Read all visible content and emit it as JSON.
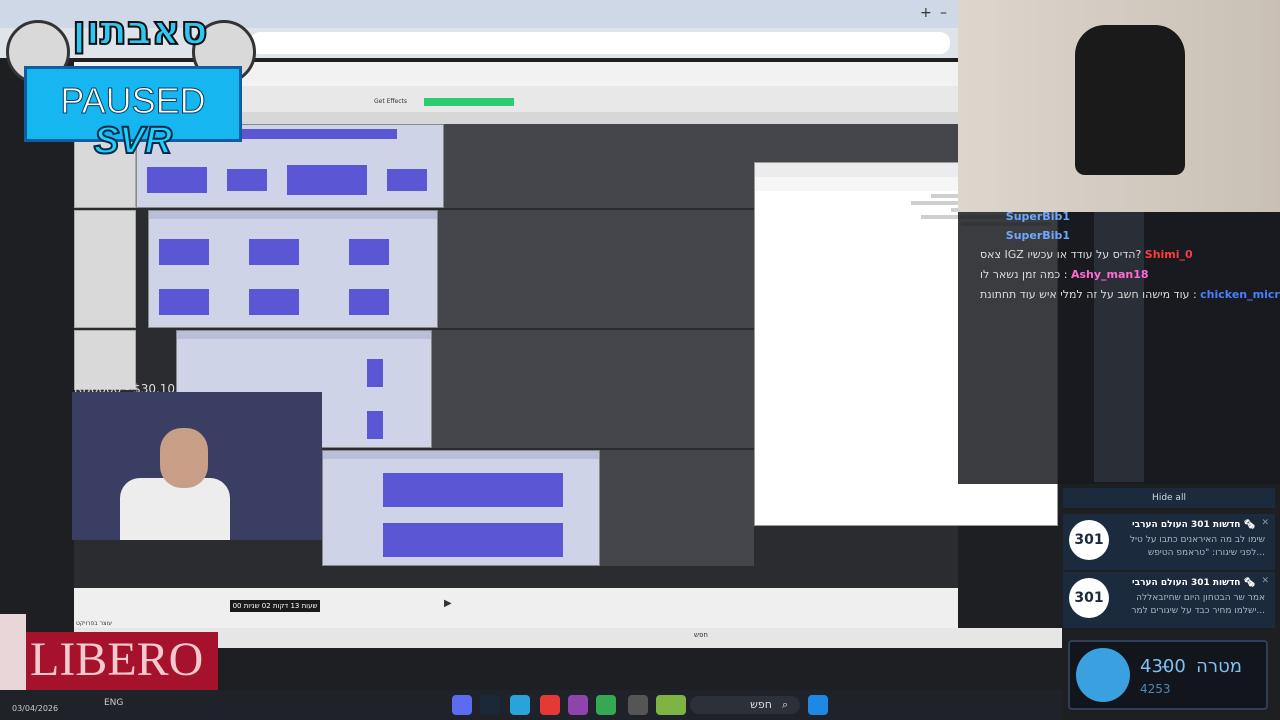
{
  "overlay": {
    "logo_text": "סאבתון",
    "paused_label": "PAUSED",
    "svr_label": "SVR",
    "donation_text": "RB6666 - $30.10",
    "sponsor": "LIBERO"
  },
  "chat": {
    "messages": [
      {
        "user": "SuperBib1",
        "text": ""
      },
      {
        "user": "SuperBib1",
        "text": ""
      },
      {
        "user": "Shimi_0",
        "text": "צאס IGZ הדיס על עודד או עכשיו?"
      },
      {
        "user": "Ashy_man18",
        "text": "כמה זמן נשאר לו"
      },
      {
        "user": "chicken_micro",
        "text": "עוד מישהו חשב על זה למלי איש עוד תחתונת"
      }
    ]
  },
  "notifications": {
    "hide_all": "Hide all",
    "items": [
      {
        "title": "חדשות 301 העולם הערבי 🗞",
        "body": "שימו לב מה האיראנים כתבו על טיל לפני שיגורו: \"טראמפ הטיפש...",
        "logo": "301"
      },
      {
        "title": "חדשות 301 העולם הערבי 🗞",
        "body": "אמר שר הבטחון היום שחיזבאללה ישלמו מחיר כבד על שיגורים למר...",
        "logo": "301"
      }
    ]
  },
  "goal": {
    "label": "מטרה",
    "value": "4300",
    "current": "4253"
  },
  "taskbar": {
    "date": "03/04/2026",
    "language": "ENG",
    "search_label": "חפש"
  },
  "audacity": {
    "inner_search": "חפש",
    "status": "עוצר בפרויקט",
    "time_display": "00 שעות 13 דקות 02 שניות",
    "get_effects": "Get Effects"
  },
  "colors": {
    "accent_paused": "#16b7f0",
    "sponsor_bg": "#a6112c",
    "waveform": "#5b57d4"
  }
}
